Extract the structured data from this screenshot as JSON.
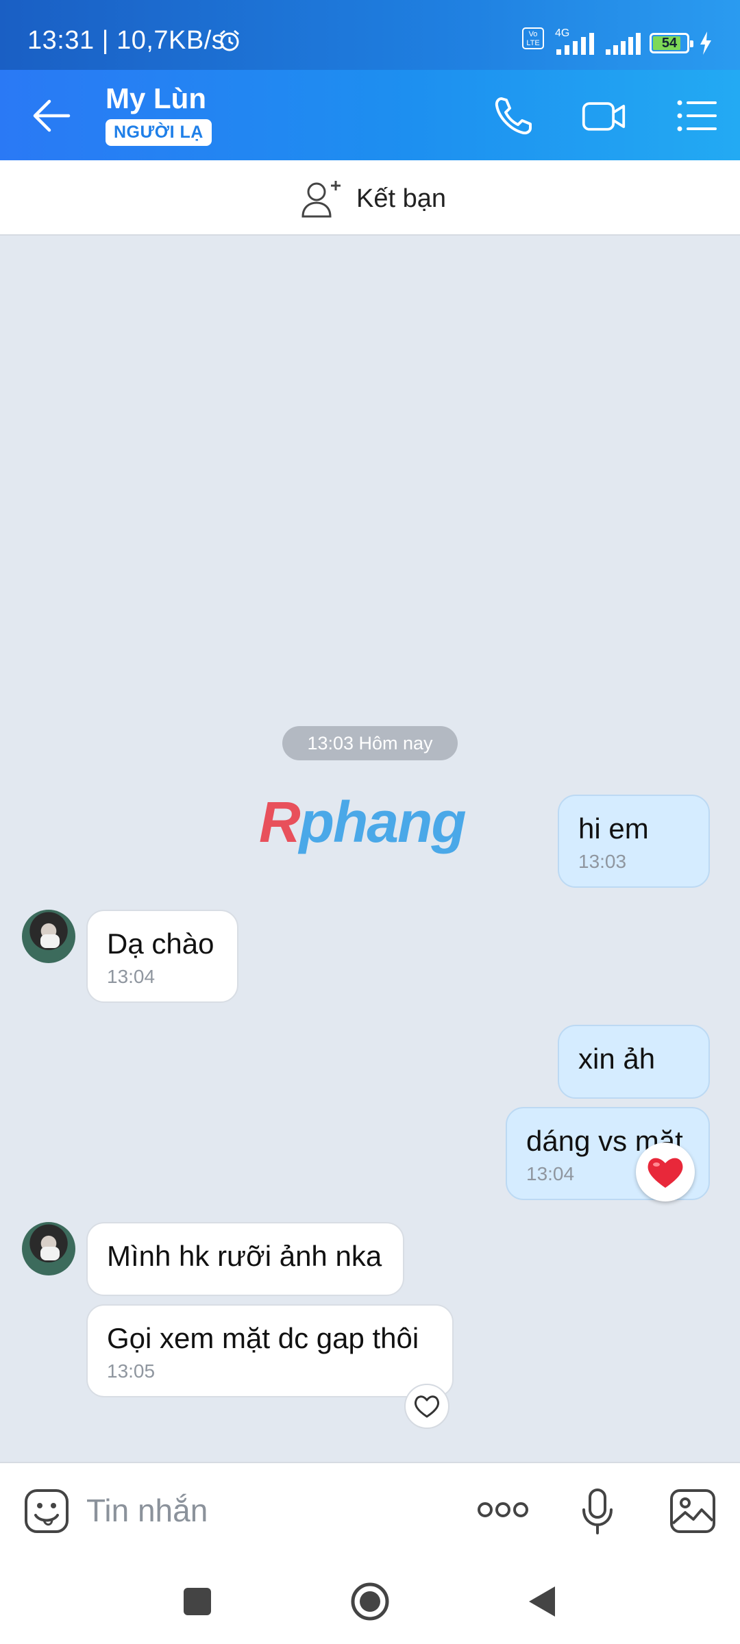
{
  "status_bar": {
    "time_speed": "13:31 | 10,7KB/s",
    "network": "4G",
    "volte": "Vo LTE",
    "battery": "54"
  },
  "header": {
    "contact_name": "My Lùn",
    "badge": "NGƯỜI LẠ",
    "icons": [
      "back-arrow-icon",
      "phone-icon",
      "video-call-icon",
      "menu-icon"
    ]
  },
  "friend_bar": {
    "label": "Kết bạn"
  },
  "chat": {
    "date_divider": "13:03 Hôm nay",
    "watermark": {
      "part1": "R",
      "part2": "phang"
    },
    "messages": [
      {
        "side": "out",
        "text": "hi em",
        "time": "13:03"
      },
      {
        "side": "in",
        "text": "Dạ chào",
        "time": "13:04"
      },
      {
        "side": "out",
        "text": "xin ảh",
        "time": ""
      },
      {
        "side": "out",
        "text": "dáng vs mặt",
        "time": "13:04",
        "reaction": "heart"
      },
      {
        "side": "in",
        "text": "Mình hk rưỡi ảnh nka",
        "time": ""
      },
      {
        "side": "in",
        "text": "Gọi xem mặt dc gap thôi",
        "time": "13:05",
        "reaction": "heart-outline"
      }
    ]
  },
  "input": {
    "placeholder": "Tin nhắn"
  },
  "colors": {
    "header_start": "#2a79f5",
    "header_end": "#23aaf3",
    "out_bubble": "#d5ecff",
    "chat_bg": "#e2e8f0"
  }
}
